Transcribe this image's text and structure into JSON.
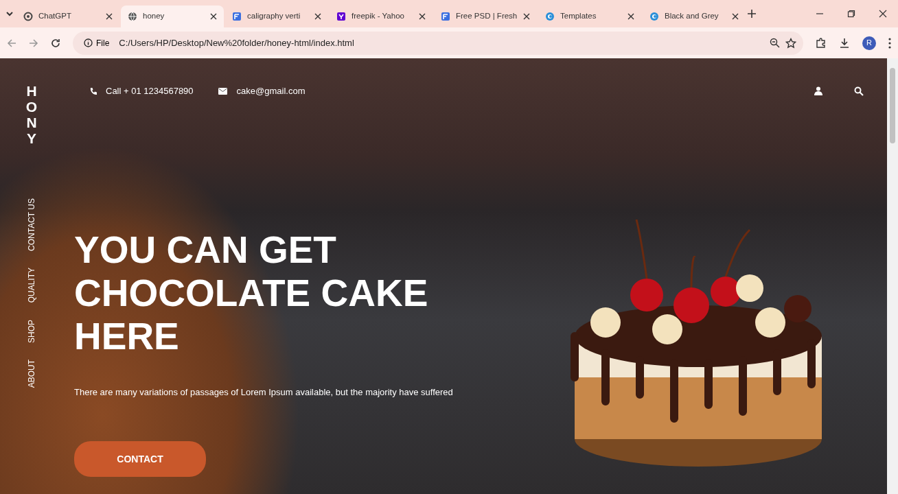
{
  "browser": {
    "tabs": [
      {
        "title": "ChatGPT",
        "kind": "chatgpt",
        "selected": false
      },
      {
        "title": "honey",
        "kind": "globe",
        "selected": true
      },
      {
        "title": "caligraphy verti",
        "kind": "doc",
        "selected": false
      },
      {
        "title": "freepik - Yahoo",
        "kind": "yahoo",
        "selected": false
      },
      {
        "title": "Free PSD | Fresh",
        "kind": "doc",
        "selected": false
      },
      {
        "title": "Templates",
        "kind": "circle",
        "selected": false
      },
      {
        "title": "Black and Grey",
        "kind": "circle",
        "selected": false
      }
    ],
    "address": {
      "chip": "File",
      "url": "C:/Users/HP/Desktop/New%20folder/honey-html/index.html"
    },
    "profile": "R"
  },
  "page": {
    "logo": "HONY",
    "phone": "Call + 01 1234567890",
    "email": "cake@gmail.com",
    "nav": [
      "CONTACT US",
      "QUALITY",
      "SHOP",
      "ABOUT"
    ],
    "title_lines": [
      "YOU CAN GET",
      "CHOCOLATE CAKE",
      "HERE"
    ],
    "text": "There are many variations of passages of Lorem Ipsum available, but the majority have suffered",
    "button": "CONTACT"
  }
}
